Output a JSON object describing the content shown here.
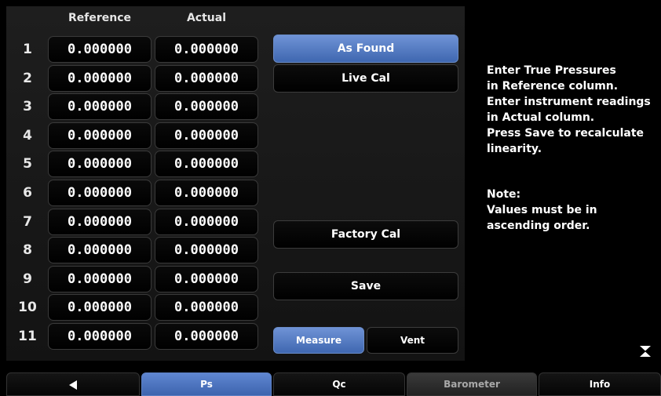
{
  "table": {
    "header_reference": "Reference",
    "header_actual": "Actual",
    "rows": [
      {
        "n": "1",
        "reference": "0.000000",
        "actual": "0.000000"
      },
      {
        "n": "2",
        "reference": "0.000000",
        "actual": "0.000000"
      },
      {
        "n": "3",
        "reference": "0.000000",
        "actual": "0.000000"
      },
      {
        "n": "4",
        "reference": "0.000000",
        "actual": "0.000000"
      },
      {
        "n": "5",
        "reference": "0.000000",
        "actual": "0.000000"
      },
      {
        "n": "6",
        "reference": "0.000000",
        "actual": "0.000000"
      },
      {
        "n": "7",
        "reference": "0.000000",
        "actual": "0.000000"
      },
      {
        "n": "8",
        "reference": "0.000000",
        "actual": "0.000000"
      },
      {
        "n": "9",
        "reference": "0.000000",
        "actual": "0.000000"
      },
      {
        "n": "10",
        "reference": "0.000000",
        "actual": "0.000000"
      },
      {
        "n": "11",
        "reference": "0.000000",
        "actual": "0.000000"
      }
    ]
  },
  "buttons": {
    "as_found": "As Found",
    "live_cal": "Live Cal",
    "factory_cal": "Factory Cal",
    "save": "Save",
    "measure": "Measure",
    "vent": "Vent"
  },
  "instructions": [
    "Enter True Pressures",
    "in Reference column.",
    "Enter instrument readings",
    "in Actual column.",
    "Press Save to recalculate",
    "linearity."
  ],
  "note": [
    "Note:",
    "Values must be in",
    "ascending order."
  ],
  "tabs": {
    "back_icon": "left-triangle-icon",
    "ps": "Ps",
    "qc": "Qc",
    "barometer": "Barometer",
    "info": "Info"
  },
  "colors": {
    "accent_blue": "#4f78c2",
    "background": "#000000",
    "panel": "#1a1a1a"
  }
}
